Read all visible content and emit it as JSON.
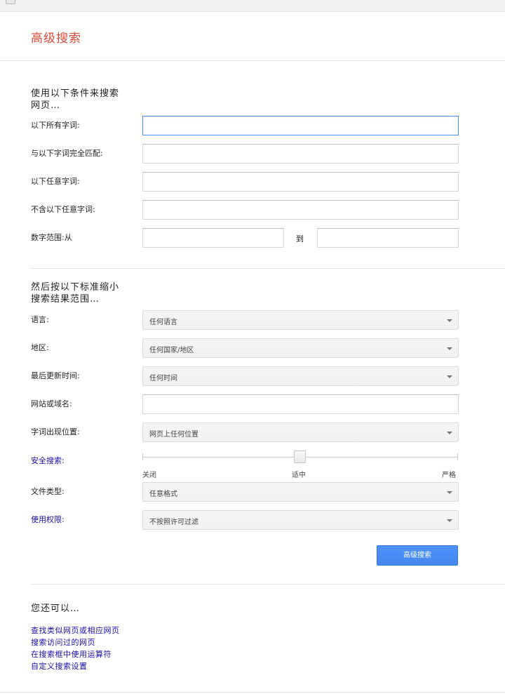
{
  "header": {
    "title": "高级搜索"
  },
  "section1": {
    "heading_line1": "使用以下条件来搜索",
    "heading_line2": "网页…",
    "rows": [
      {
        "label": "以下所有字词:",
        "value": ""
      },
      {
        "label": "与以下字词完全匹配:",
        "value": ""
      },
      {
        "label": "以下任意字词:",
        "value": ""
      },
      {
        "label": "不含以下任意字词:",
        "value": ""
      }
    ],
    "range": {
      "label": "数字范围:从",
      "to_label": "到",
      "from_value": "",
      "to_value": ""
    }
  },
  "section2": {
    "heading_line1": "然后按以下标准缩小",
    "heading_line2": "搜索结果范围…",
    "language": {
      "label": "语言:",
      "selected": "任何语言"
    },
    "region": {
      "label": "地区:",
      "selected": "任何国家/地区"
    },
    "last_update": {
      "label": "最后更新时间:",
      "selected": "任何时间"
    },
    "site": {
      "label": "网站或域名:",
      "value": ""
    },
    "terms_position": {
      "label": "字词出现位置:",
      "selected": "网页上任何位置"
    },
    "safesearch": {
      "label": "安全搜索:",
      "options": [
        "关闭",
        "适中",
        "严格"
      ],
      "level": 0.5
    },
    "file_type": {
      "label": "文件类型:",
      "selected": "任意格式"
    },
    "usage_rights": {
      "label": "使用权限:",
      "selected": "不按照许可过滤"
    }
  },
  "submit": {
    "label": "高级搜索"
  },
  "more": {
    "heading": "您还可以…",
    "links": [
      "查找类似网页或相应网页",
      "搜索访问过的网页",
      "在搜索框中使用运算符",
      "自定义搜索设置"
    ]
  },
  "colors": {
    "title": "#dd4b39",
    "link": "#1a0dab",
    "button": "#4d90fe"
  }
}
